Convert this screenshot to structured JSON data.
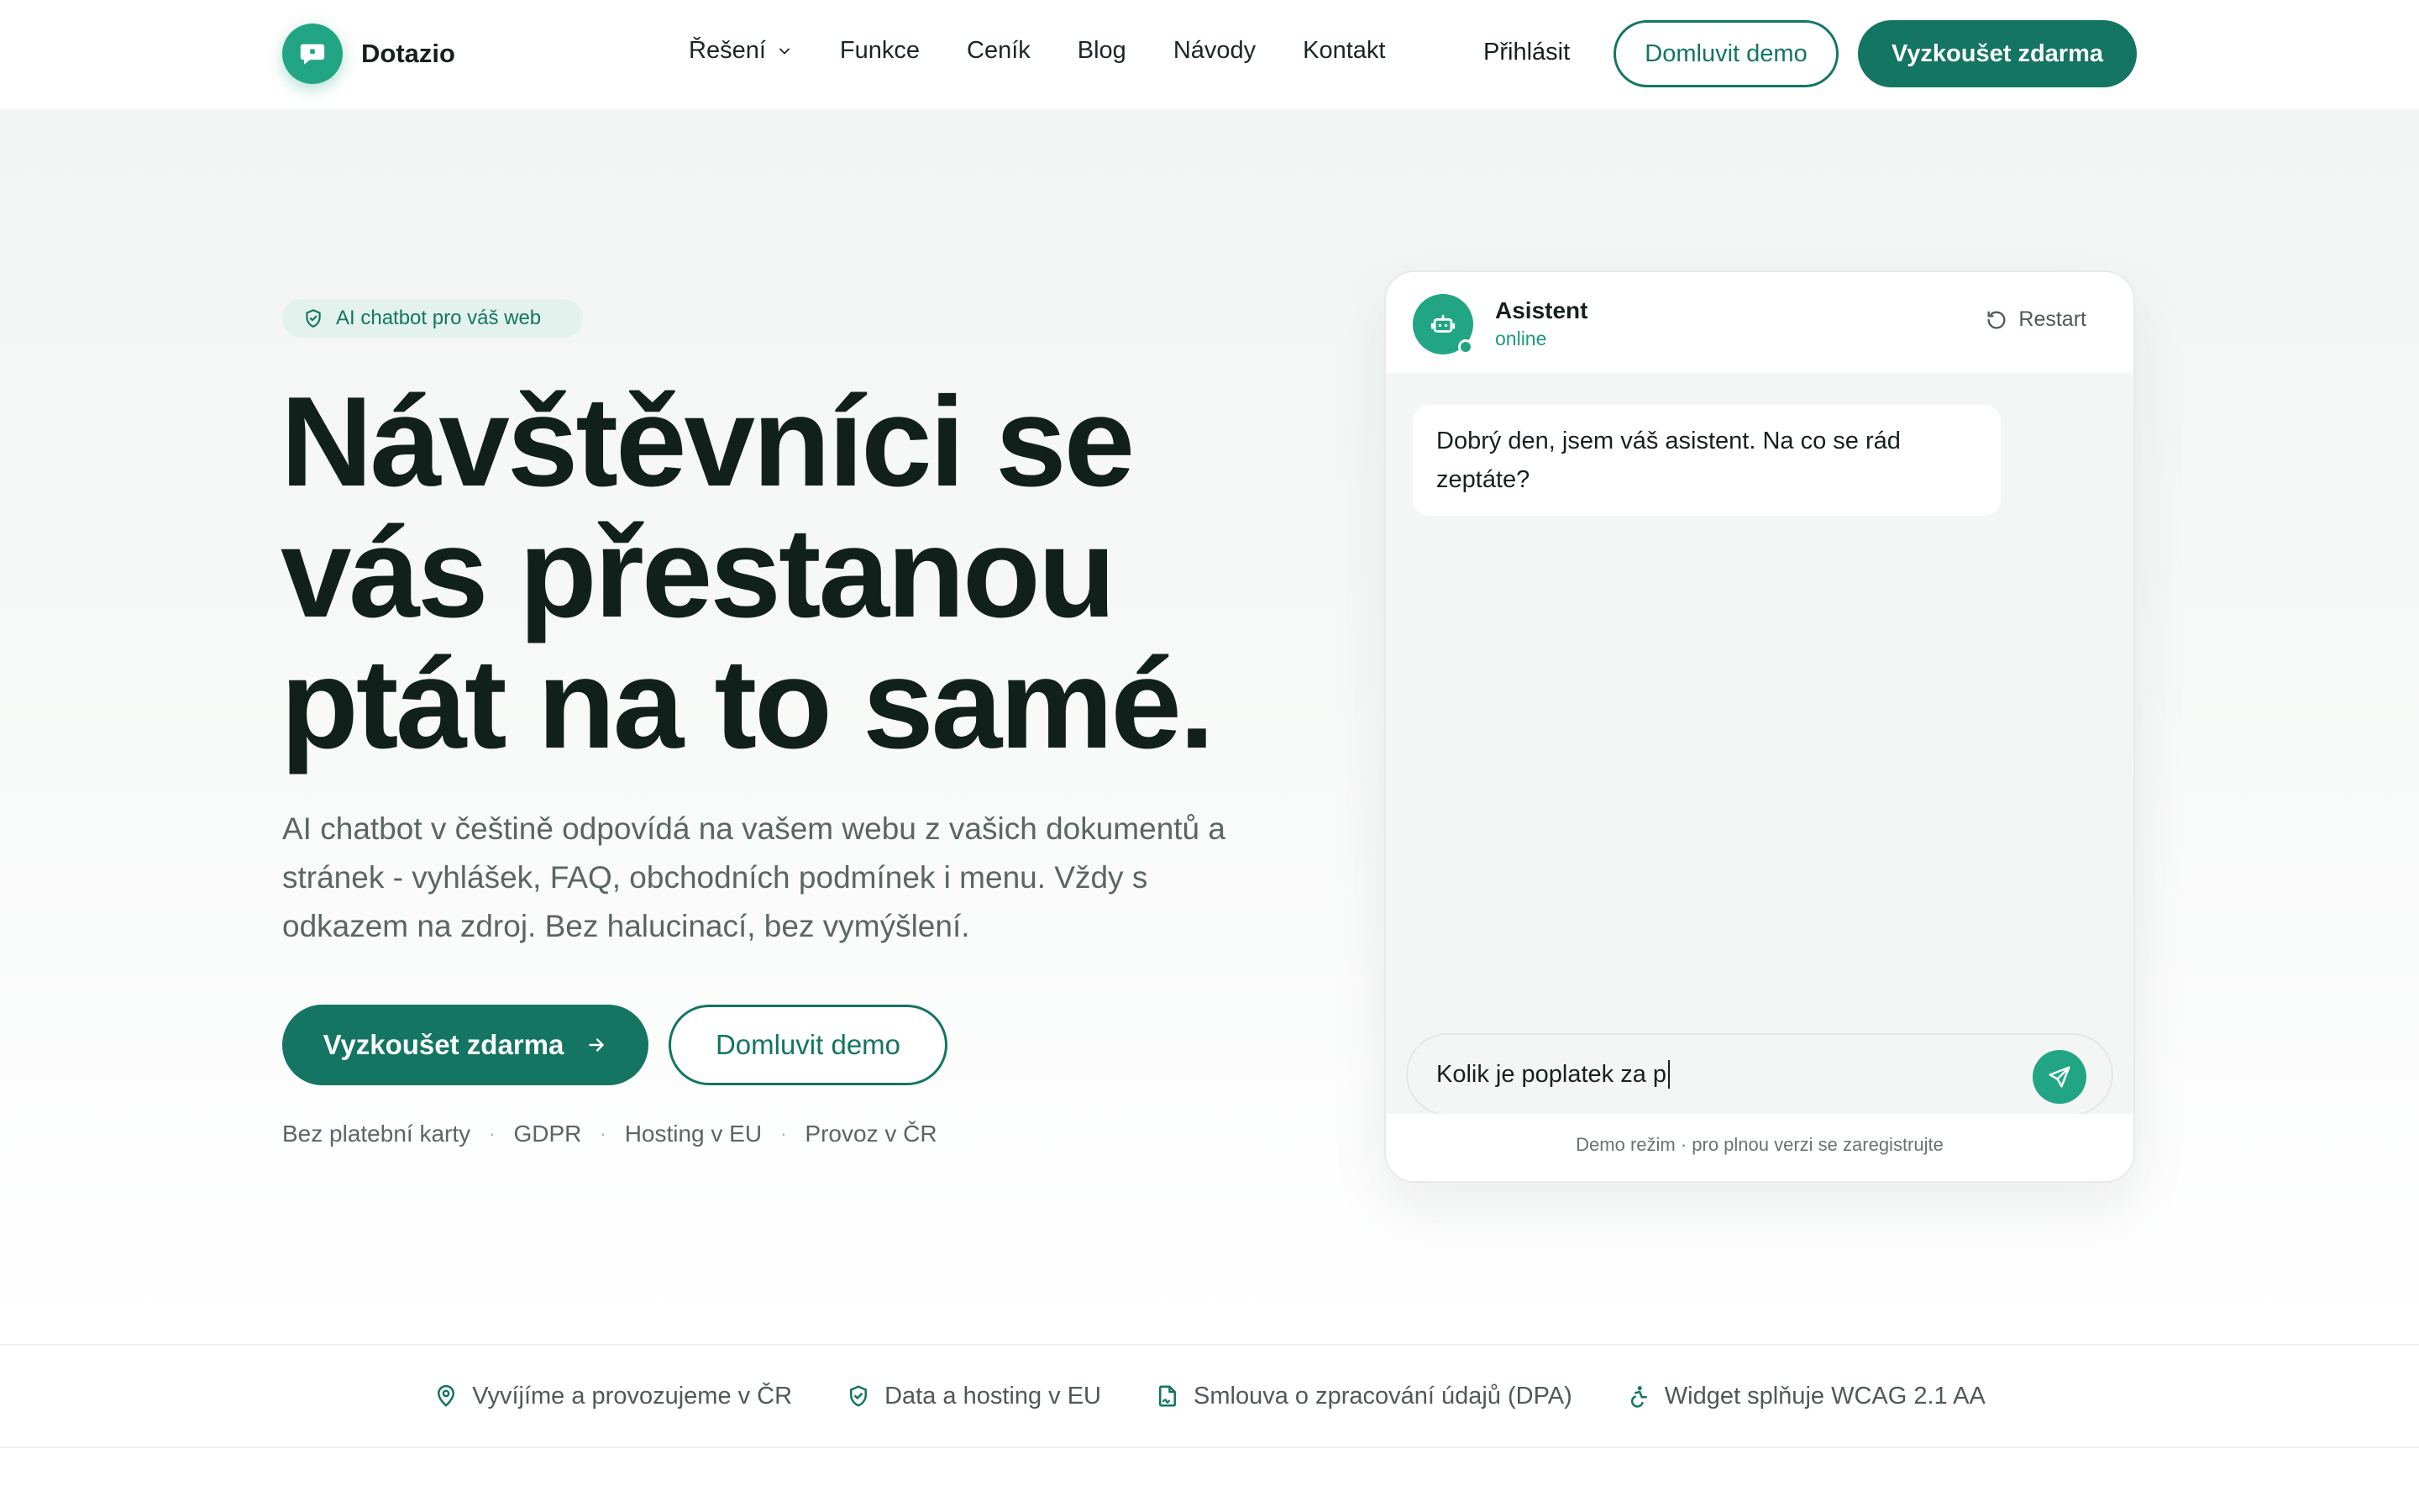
{
  "header": {
    "brand": "Dotazio",
    "nav": [
      "Řešení",
      "Funkce",
      "Ceník",
      "Blog",
      "Návody",
      "Kontakt"
    ],
    "login": "Přihlásit",
    "demo_button": "Domluvit demo",
    "trial_button": "Vyzkoušet zdarma"
  },
  "hero": {
    "badge": "AI chatbot pro váš web",
    "headline": [
      "Návštěvníci se",
      "vás přestanou",
      "ptát na to samé."
    ],
    "lead": "AI chatbot v češtině odpovídá na vašem webu z vašich dokumentů a stránek - vyhlášek, FAQ, obchodních podmínek i menu. Vždy s odkazem na zdroj. Bez halucinací, bez vymýšlení.",
    "primary_button": "Vyzkoušet zdarma",
    "secondary_button": "Domluvit demo",
    "features": [
      "Bez platební karty",
      "GDPR",
      "Hosting v EU",
      "Provoz v ČR"
    ],
    "feature_separator": "·"
  },
  "chat": {
    "name": "Asistent",
    "status": "online",
    "restart": "Restart",
    "messages": [
      {
        "from": "bot",
        "text": "Dobrý den, jsem váš asistent. Na co se rád zeptáte?"
      }
    ],
    "input_value": "Kolik je poplatek za p",
    "note": "Demo režim · pro plnou verzi se zaregistrujte"
  },
  "trust": [
    {
      "icon": "map-pin-icon",
      "label": "Vyvíjíme a provozujeme v ČR"
    },
    {
      "icon": "shield-icon",
      "label": "Data a hosting v EU"
    },
    {
      "icon": "document-signature-icon",
      "label": "Smlouva o zpracování údajů (DPA)"
    },
    {
      "icon": "accessibility-icon",
      "label": "Widget splňuje WCAG 2.1 AA"
    }
  ],
  "colors": {
    "brand": "#137562",
    "accent": "#22a585",
    "text": "#11201b",
    "muted": "#5b6662"
  }
}
